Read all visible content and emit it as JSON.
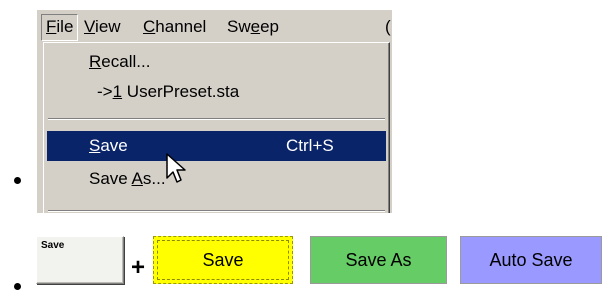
{
  "menubar": {
    "items": [
      {
        "label": "File",
        "key": "F"
      },
      {
        "label": "View",
        "key": "V"
      },
      {
        "label": "Channel",
        "key": "C"
      },
      {
        "label": "Sweep",
        "key": "e"
      }
    ]
  },
  "file_menu": {
    "recall": "Recall...",
    "recent_prefix": "->",
    "recent_num": "1",
    "recent_file": " UserPreset.sta",
    "save": "Save",
    "save_shortcut": "Ctrl+S",
    "save_as": "Save As..."
  },
  "buttons": {
    "save_icon": "Save",
    "plus": "+",
    "save": "Save",
    "save_as": "Save As",
    "auto_save": "Auto Save"
  },
  "colors": {
    "highlight": "#0a246a",
    "menu_bg": "#d4d0c8",
    "save_btn": "#ffff00",
    "save_as_btn": "#66cc66",
    "auto_save_btn": "#9999ff"
  }
}
